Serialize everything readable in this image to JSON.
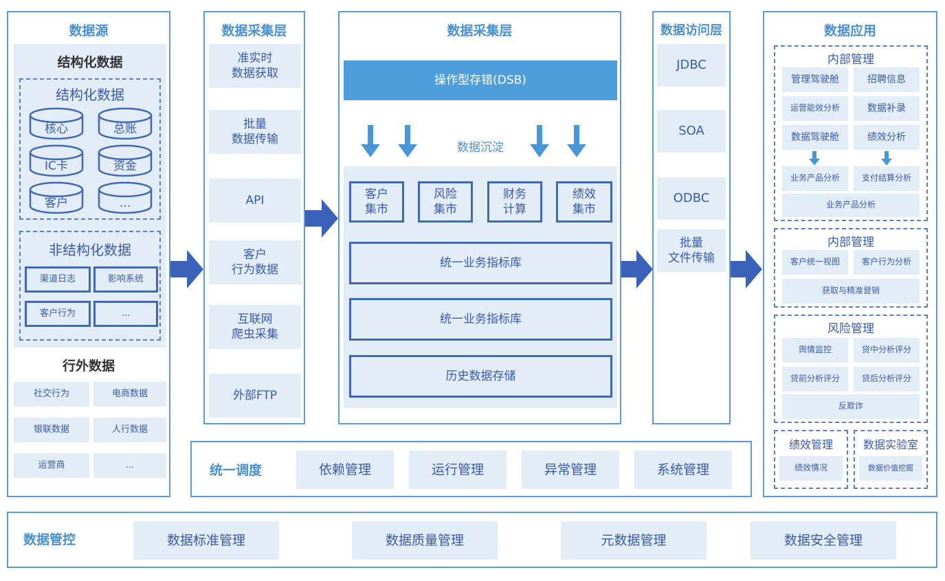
{
  "colors": {
    "panel_border": "#5b9bd5",
    "title_blue": "#4a90cf",
    "cell_bg": "#e3edf8",
    "text_blue": "#3a5aa6",
    "box_border": "#3f67b3",
    "arrow_blue": "#3a62b8",
    "dsb_bg": "#4e9edc",
    "down_arrow": "#4a97d8"
  },
  "source": {
    "title": "数据源",
    "structured_heading": "结构化数据",
    "structured_group_title": "结构化数据",
    "databases": [
      "核心",
      "总账",
      "IC卡",
      "资金",
      "客户",
      "..."
    ],
    "unstructured_title": "非结构化数据",
    "unstructured_items": [
      "渠道日志",
      "影响系统",
      "客户行为",
      "..."
    ],
    "external_title": "行外数据",
    "external_items": [
      "社交行为",
      "电商数据",
      "银联数据",
      "人行数据",
      "运营商",
      "..."
    ]
  },
  "collect": {
    "title": "数据采集层",
    "items": [
      {
        "line1": "准实时",
        "line2": "数据获取"
      },
      {
        "line1": "批量",
        "line2": "数据传输"
      },
      {
        "line1": "API",
        "line2": ""
      },
      {
        "line1": "客户",
        "line2": "行为数据"
      },
      {
        "line1": "互联网",
        "line2": "爬虫采集"
      },
      {
        "line1": "外部FTP",
        "line2": ""
      }
    ]
  },
  "storage": {
    "title": "数据采集层",
    "dsb": "操作型存错(DSB)",
    "sediment": "数据沉淀",
    "marts": [
      {
        "line1": "客户",
        "line2": "集市"
      },
      {
        "line1": "风险",
        "line2": "集市"
      },
      {
        "line1": "财务",
        "line2": "计算"
      },
      {
        "line1": "绩效",
        "line2": "集市"
      }
    ],
    "layers": [
      "统一业务指标库",
      "统一业务指标库",
      "历史数据存储"
    ]
  },
  "access": {
    "title": "数据访问层",
    "items": [
      {
        "line1": "JDBC",
        "line2": ""
      },
      {
        "line1": "SOA",
        "line2": ""
      },
      {
        "line1": "ODBC",
        "line2": ""
      },
      {
        "line1": "批量",
        "line2": "文件传输"
      }
    ]
  },
  "apps": {
    "title": "数据应用",
    "internal1": {
      "title": "内部管理",
      "rows": [
        [
          "管理驾驶舱",
          "招聘信息"
        ],
        [
          "运营能效分析",
          "数据补录"
        ],
        [
          "数据驾驶舱",
          "绩效分析"
        ],
        [
          "业务产品分析",
          "支付结算分析"
        ]
      ],
      "full": "业务产品分析"
    },
    "internal2": {
      "title": "内部管理",
      "items": [
        "客户统一视图",
        "客户行为分析"
      ],
      "full": "获取与精准营销"
    },
    "risk": {
      "title": "风险管理",
      "items": [
        "舆情监控",
        "贷中分析评分",
        "贷前分析评分",
        "贷后分析评分"
      ],
      "full": "反欺诈"
    },
    "perf": {
      "title": "绩效管理",
      "item": "绩效情况"
    },
    "lab": {
      "title": "数据实验室",
      "item": "数据价值挖掘"
    }
  },
  "schedule": {
    "title": "统一调度",
    "items": [
      "依赖管理",
      "运行管理",
      "异常管理",
      "系统管理"
    ]
  },
  "governance": {
    "title": "数据管控",
    "items": [
      "数据标准管理",
      "数据质量管理",
      "元数据管理",
      "数据安全管理"
    ]
  }
}
